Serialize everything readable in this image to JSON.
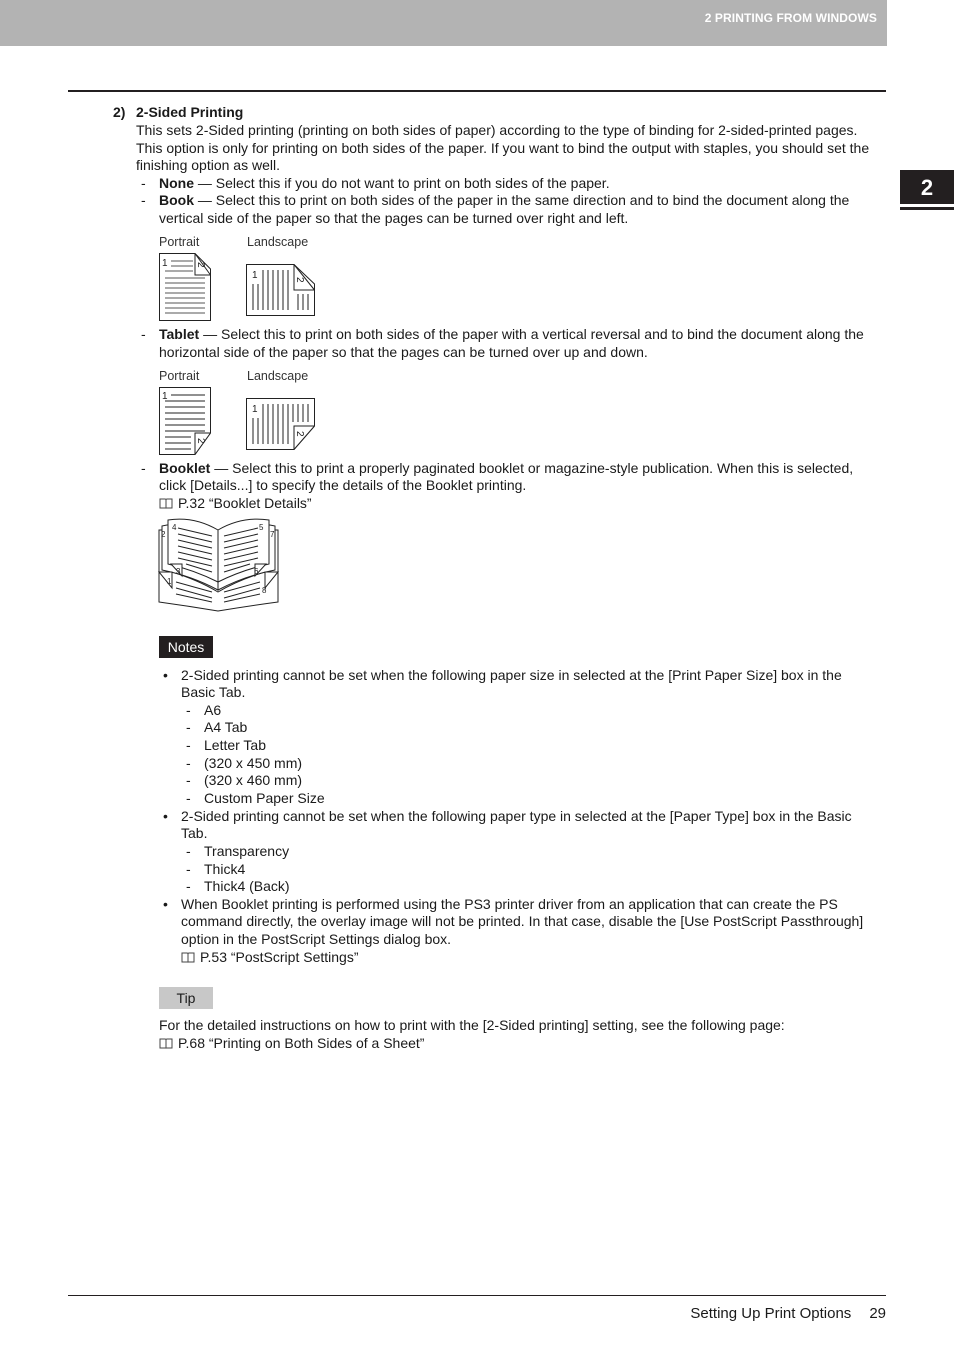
{
  "header": {
    "chapter_title": "2 PRINTING FROM WINDOWS",
    "chapter_tab": "2"
  },
  "section": {
    "number": "2)",
    "title": "2-Sided Printing",
    "intro_lines": [
      "This sets 2-Sided printing (printing on both sides of paper) according to the type of binding for 2-sided-printed pages.",
      "This option is only for printing on both sides of the paper. If you want to bind the output with staples, you should set the",
      "finishing option as well."
    ],
    "options": [
      {
        "name": "None",
        "lines": [
          " — Select this if you do not want to print on both sides of the paper."
        ]
      },
      {
        "name": "Book",
        "lines": [
          " — Select this to print on both sides of the paper in the same direction and to bind the document along the",
          "vertical side of the paper so that the pages can be turned over right and left."
        ]
      },
      {
        "name": "Tablet",
        "lines": [
          " — Select this to print on both sides of the paper with a vertical reversal and to bind the document along the",
          "horizontal side of the paper so that the pages can be turned over up and down."
        ]
      },
      {
        "name": "Booklet",
        "lines": [
          " — Select this to print a properly paginated booklet or magazine-style publication.  When this is selected,",
          "click [Details...] to specify the details of the Booklet printing."
        ]
      }
    ],
    "figure_labels": {
      "portrait": "Portrait",
      "landscape": "Landscape"
    },
    "page_numbers": {
      "one": "1",
      "two": "2"
    },
    "booklet_pages": [
      "1",
      "2",
      "3",
      "4",
      "5",
      "6",
      "7",
      "8"
    ],
    "booklet_ref": "P.32 “Booklet Details”",
    "dash": "-"
  },
  "notes": {
    "label": "Notes",
    "bullet": "•",
    "items": [
      {
        "lines": [
          "2-Sided printing cannot be set when the following paper size in selected at the [Print Paper Size] box in the",
          "Basic Tab."
        ],
        "sub": [
          "A6",
          "A4 Tab",
          "Letter Tab",
          "(320 x 450 mm)",
          "(320 x 460 mm)",
          "Custom Paper Size"
        ]
      },
      {
        "lines": [
          "2-Sided printing cannot be set when the following paper type in selected at the [Paper Type] box in the Basic",
          "Tab."
        ],
        "sub": [
          "Transparency",
          "Thick4",
          "Thick4 (Back)"
        ]
      },
      {
        "lines": [
          "When Booklet printing is performed using the PS3 printer driver from an application that can create the PS",
          "command directly, the overlay image will not be printed. In that case, disable the [Use PostScript Passthrough]",
          "option in the PostScript Settings dialog box."
        ],
        "ref": "P.53 “PostScript Settings”"
      }
    ]
  },
  "tip": {
    "label": "Tip",
    "text": "For the detailed instructions on how to print with the [2-Sided printing] setting, see the following page:",
    "ref": "P.68 “Printing on Both Sides of a Sheet”"
  },
  "footer": {
    "section_title": "Setting Up Print Options",
    "page_number": "29"
  }
}
